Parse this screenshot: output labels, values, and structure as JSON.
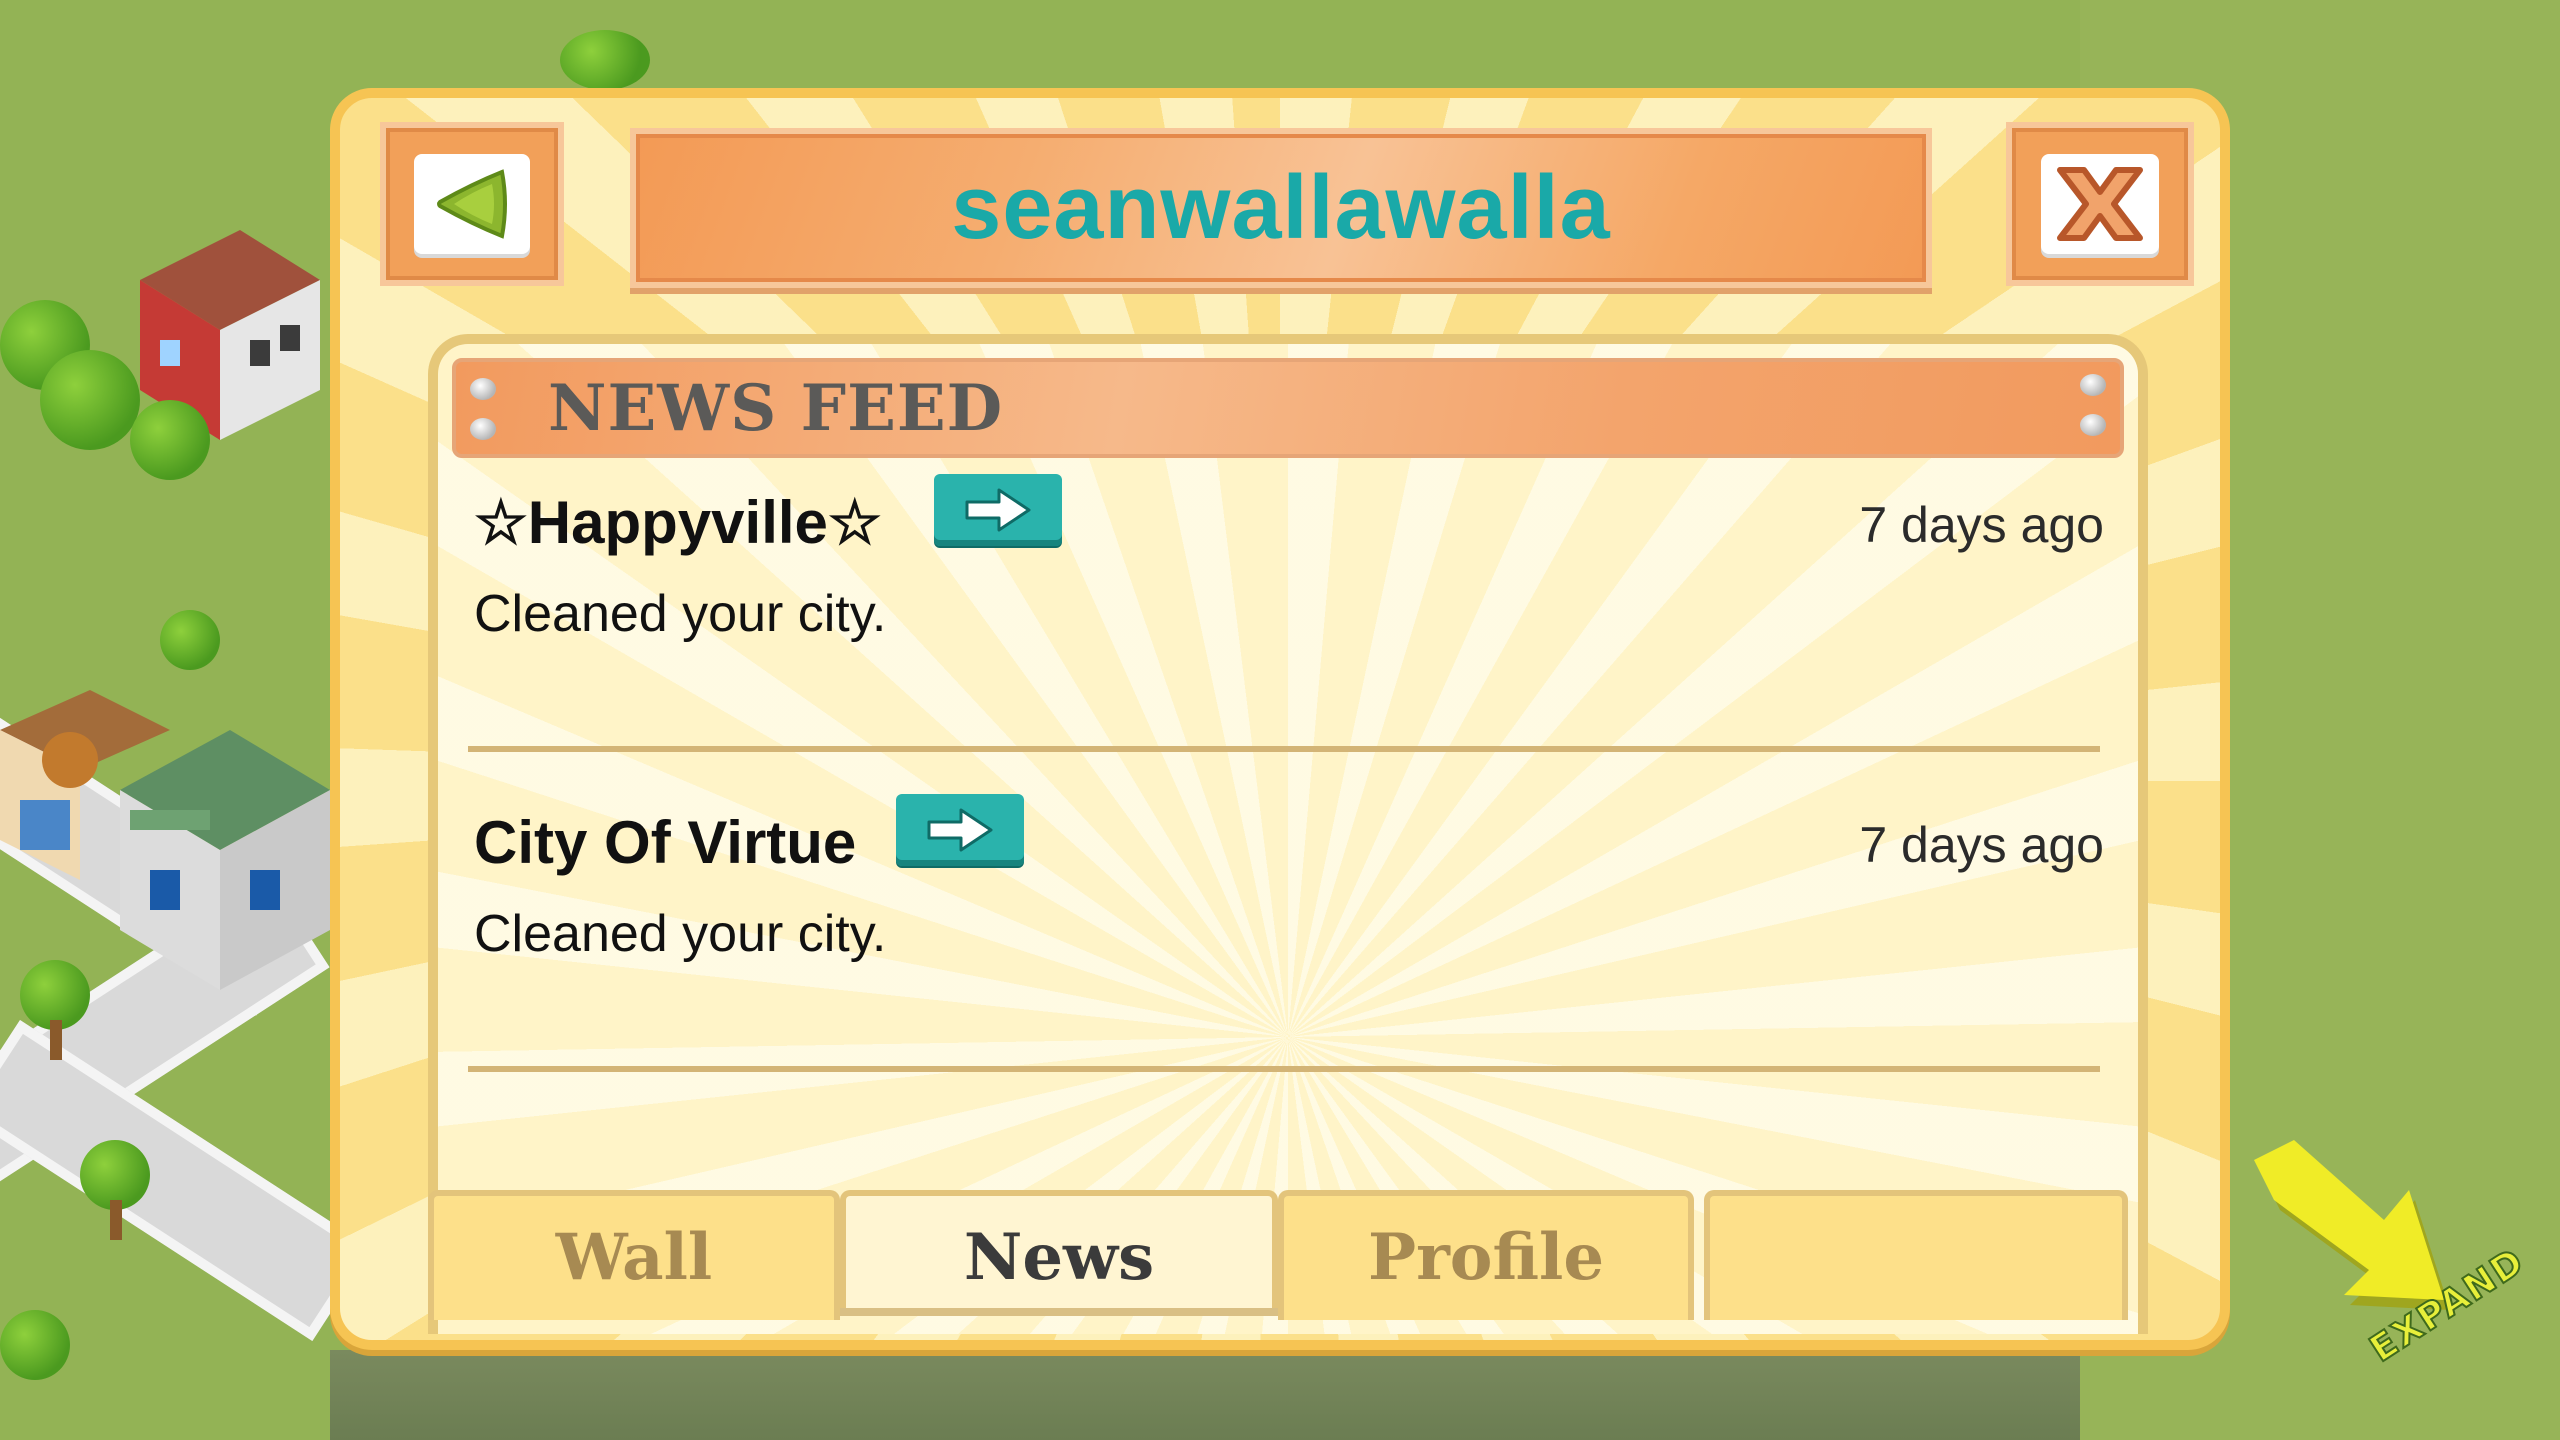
{
  "profile": {
    "username": "seanwallawalla"
  },
  "header": {
    "back_button": "back-arrow-icon",
    "close_button": "close-x-icon"
  },
  "news_feed": {
    "title": "NEWS FEED",
    "entries": [
      {
        "name": "☆Happyville☆",
        "time": "7 days ago",
        "message": "Cleaned your city."
      },
      {
        "name": "City Of Virtue",
        "time": "7 days ago",
        "message": "Cleaned your city."
      }
    ]
  },
  "tabs": [
    {
      "label": "Wall",
      "active": false
    },
    {
      "label": "News",
      "active": true
    },
    {
      "label": "Profile",
      "active": false
    },
    {
      "label": "",
      "active": false
    }
  ],
  "expand": {
    "label": "EXPAND"
  },
  "colors": {
    "title_text": "#1aa9a8",
    "go_button": "#2ab3ac",
    "panel_bg": "#fbe08a",
    "grass": "#93b355"
  }
}
